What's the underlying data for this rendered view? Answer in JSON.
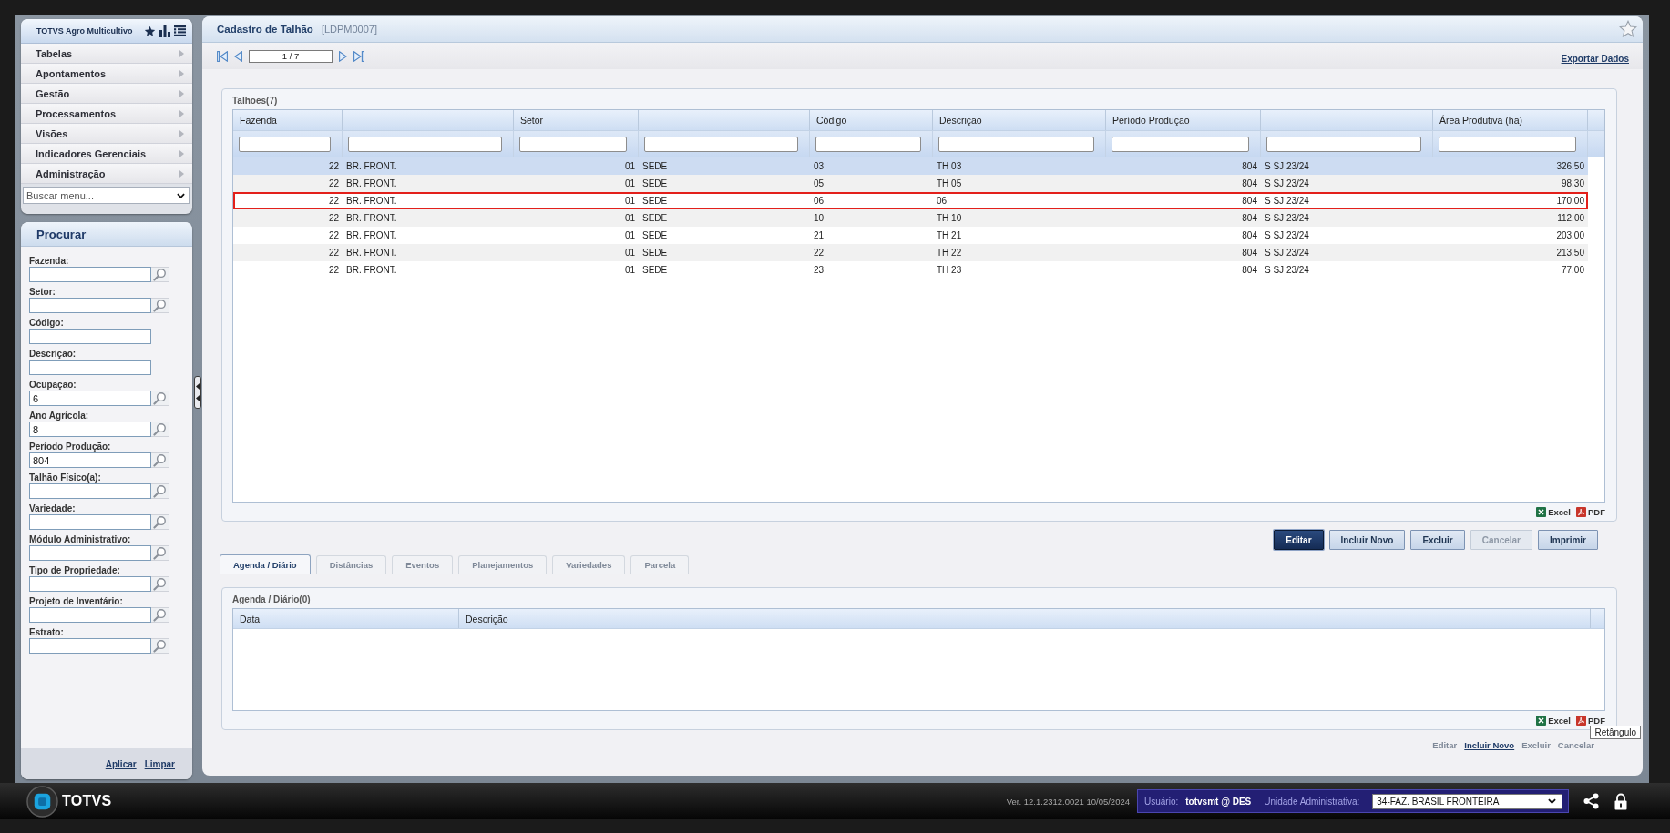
{
  "menu": {
    "title": "TOTVS Agro Multicultivo",
    "items": [
      {
        "label": "Tabelas"
      },
      {
        "label": "Apontamentos"
      },
      {
        "label": "Gestão"
      },
      {
        "label": "Processamentos"
      },
      {
        "label": "Visões"
      },
      {
        "label": "Indicadores Gerenciais"
      },
      {
        "label": "Administração"
      }
    ],
    "search": {
      "placeholder": "Buscar menu..."
    }
  },
  "search_panel": {
    "title": "Procurar",
    "fields": [
      {
        "label": "Fazenda:",
        "kind": "lookup"
      },
      {
        "label": "Setor:",
        "kind": "lookup"
      },
      {
        "label": "Código:",
        "kind": "text"
      },
      {
        "label": "Descrição:",
        "kind": "text"
      },
      {
        "label": "Ocupação:",
        "kind": "lookup",
        "value": "6"
      },
      {
        "label": "Ano Agrícola:",
        "kind": "lookup",
        "value": "8"
      },
      {
        "label": "Período Produção:",
        "kind": "lookup",
        "value": "804"
      },
      {
        "label": "Talhão Físico(a):",
        "kind": "lookup"
      },
      {
        "label": "Variedade:",
        "kind": "lookup"
      },
      {
        "label": "Módulo Administrativo:",
        "kind": "lookup"
      },
      {
        "label": "Tipo de Propriedade:",
        "kind": "lookup"
      },
      {
        "label": "Projeto de Inventário:",
        "kind": "lookup"
      },
      {
        "label": "Estrato:",
        "kind": "lookup"
      }
    ],
    "actions": [
      "Aplicar",
      "Limpar"
    ]
  },
  "window": {
    "title": "Cadastro de Talhão",
    "code": "[LDPM0007]"
  },
  "pager": {
    "value": "1 / 7"
  },
  "export_link": "Exportar Dados",
  "grid": {
    "title": "Talhões(7)",
    "columns": [
      {
        "label": "Fazenda"
      },
      {},
      {
        "label": "Setor"
      },
      {},
      {
        "label": "Código"
      },
      {
        "label": "Descrição"
      },
      {
        "label": "Período Produção"
      },
      {},
      {
        "label": "Área Produtiva (ha)"
      }
    ],
    "rows": [
      {
        "cells": [
          "22",
          "BR. FRONT.",
          "01",
          "SEDE",
          "03",
          "TH 03",
          "804",
          "S SJ 23/24",
          "326.50"
        ],
        "selected": true,
        "annotated": false
      },
      {
        "cells": [
          "22",
          "BR. FRONT.",
          "01",
          "SEDE",
          "05",
          "TH 05",
          "804",
          "S SJ 23/24",
          "98.30"
        ],
        "selected": false,
        "annotated": false
      },
      {
        "cells": [
          "22",
          "BR. FRONT.",
          "01",
          "SEDE",
          "06",
          "06",
          "804",
          "S SJ 23/24",
          "170.00"
        ],
        "selected": false,
        "annotated": true
      },
      {
        "cells": [
          "22",
          "BR. FRONT.",
          "01",
          "SEDE",
          "10",
          "TH 10",
          "804",
          "S SJ 23/24",
          "112.00"
        ],
        "selected": false,
        "annotated": false
      },
      {
        "cells": [
          "22",
          "BR. FRONT.",
          "01",
          "SEDE",
          "21",
          "TH 21",
          "804",
          "S SJ 23/24",
          "203.00"
        ],
        "selected": false,
        "annotated": false
      },
      {
        "cells": [
          "22",
          "BR. FRONT.",
          "01",
          "SEDE",
          "22",
          "TH 22",
          "804",
          "S SJ 23/24",
          "213.50"
        ],
        "selected": false,
        "annotated": false
      },
      {
        "cells": [
          "22",
          "BR. FRONT.",
          "01",
          "SEDE",
          "23",
          "TH 23",
          "804",
          "S SJ 23/24",
          "77.00"
        ],
        "selected": false,
        "annotated": false
      }
    ],
    "exports": [
      {
        "label": "Excel",
        "kind": "excel"
      },
      {
        "label": "PDF",
        "kind": "pdf"
      }
    ]
  },
  "actions": [
    {
      "label": "Editar",
      "kind": "primary",
      "disabled": false
    },
    {
      "label": "Incluir Novo",
      "kind": "secondary",
      "disabled": false
    },
    {
      "label": "Excluir",
      "kind": "secondary",
      "disabled": false
    },
    {
      "label": "Cancelar",
      "kind": "secondary",
      "disabled": true
    },
    {
      "label": "Imprimir",
      "kind": "secondary",
      "disabled": false
    }
  ],
  "tabs": [
    {
      "label": "Agenda / Diário",
      "selected": true,
      "disabled": false
    },
    {
      "label": "Distâncias",
      "selected": false,
      "disabled": true
    },
    {
      "label": "Eventos",
      "selected": false,
      "disabled": true
    },
    {
      "label": "Planejamentos",
      "selected": false,
      "disabled": true
    },
    {
      "label": "Variedades",
      "selected": false,
      "disabled": true
    },
    {
      "label": "Parcela",
      "selected": false,
      "disabled": true
    }
  ],
  "detail_grid": {
    "title": "Agenda / Diário(0)",
    "columns": [
      {
        "label": "Data"
      },
      {
        "label": "Descrição"
      }
    ],
    "exports": [
      {
        "label": "Excel",
        "kind": "excel"
      },
      {
        "label": "PDF",
        "kind": "pdf"
      }
    ]
  },
  "detail_actions": [
    {
      "label": "Editar",
      "disabled": true
    },
    {
      "label": "Incluir Novo",
      "disabled": false
    },
    {
      "label": "Excluir",
      "disabled": true
    },
    {
      "label": "Cancelar",
      "disabled": true
    }
  ],
  "tooltip": {
    "text": "Retângulo"
  },
  "status_bar": {
    "brand": "TOTVS",
    "version": "Ver. 12.1.2312.0021 10/05/2024",
    "user_label": "Usuário:",
    "user": "totvsmt @ DES",
    "unit_label": "Unidade Administrativa:",
    "unit": "34-FAZ. BRASIL FRONTEIRA"
  }
}
